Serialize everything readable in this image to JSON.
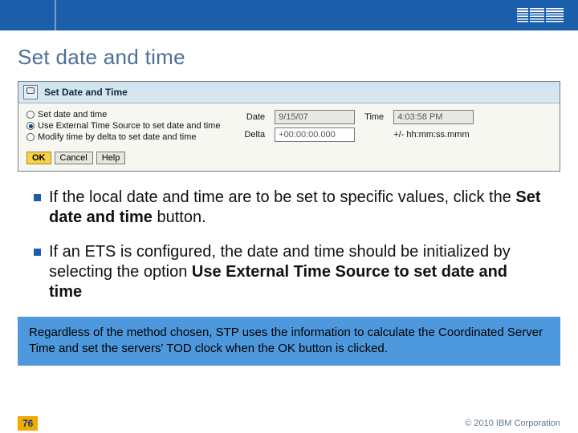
{
  "header": {
    "logo_alt": "IBM"
  },
  "title": "Set date and time",
  "panel": {
    "header_title": "Set Date and Time",
    "radios": {
      "opt1": "Set date and time",
      "opt2": "Use External Time Source to set date and time",
      "opt3": "Modify time by delta to set date and time"
    },
    "fields": {
      "date_label": "Date",
      "date_value": "9/15/07",
      "time_label": "Time",
      "time_value": "4:03:58 PM",
      "delta_label": "Delta",
      "delta_value": "+00:00:00.000",
      "delta_hint": "+/- hh:mm:ss.mmm"
    },
    "buttons": {
      "ok": "OK",
      "cancel": "Cancel",
      "help": "Help"
    }
  },
  "bullets": {
    "b1_pre": "If the local date and time are to be set to specific values, click the ",
    "b1_bold": "Set date and time",
    "b1_post": " button.",
    "b2_pre": "If an ETS is configured, the date and time should be initialized by selecting the option ",
    "b2_bold": "Use External Time Source to set date and time",
    "b2_post": ""
  },
  "callout": "Regardless of the method chosen, STP uses the information to calculate the Coordinated Server Time and set the servers' TOD clock when the OK button is clicked.",
  "footer": {
    "page": "76",
    "copyright": "© 2010 IBM Corporation"
  }
}
